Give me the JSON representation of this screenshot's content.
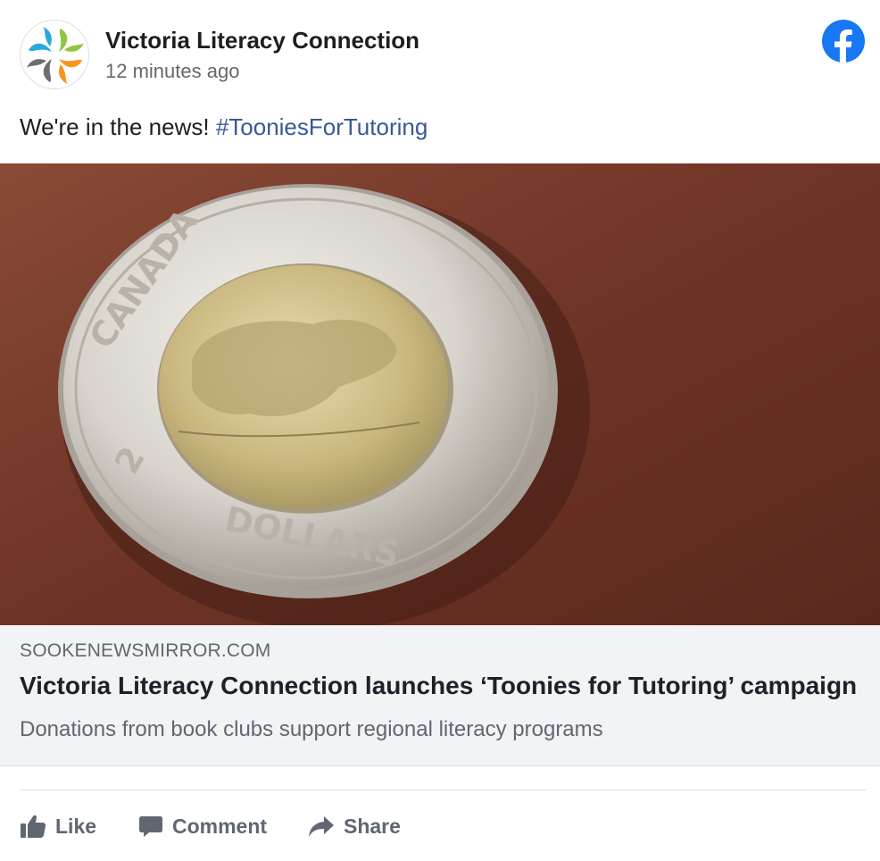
{
  "header": {
    "page_name": "Victoria Literacy Connection",
    "timestamp": "12 minutes ago",
    "avatar_icon": "literacy-connection-logo-icon",
    "platform_icon": "facebook-icon"
  },
  "post": {
    "text": "We're in the news! ",
    "hashtag": "#TooniesForTutoring"
  },
  "link_preview": {
    "image_alt": "Canadian two dollar coin (toonie) with polar bear on brown leather",
    "coin_text_top": "CANADA",
    "coin_text_bottom": "DOLLARS",
    "coin_text_value": "2",
    "domain": "SOOKENEWSMIRROR.COM",
    "title": "Victoria Literacy Connection launches ‘Toonies for Tutoring’ campaign",
    "description": "Donations from book clubs support regional literacy programs"
  },
  "actions": {
    "like_label": "Like",
    "comment_label": "Comment",
    "share_label": "Share"
  },
  "colors": {
    "facebook_blue": "#1877f2",
    "hashtag_blue": "#385898",
    "meta_background": "#f2f3f5",
    "secondary_text": "#606770"
  }
}
